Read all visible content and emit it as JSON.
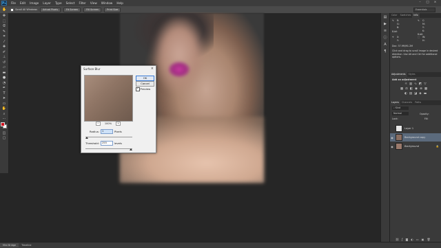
{
  "app": {
    "logo": "Ps"
  },
  "menu": [
    "File",
    "Edit",
    "Image",
    "Layer",
    "Type",
    "Select",
    "Filter",
    "View",
    "Window",
    "Help"
  ],
  "window_controls": [
    "–",
    "□",
    "×"
  ],
  "options_bar": {
    "tool_icon": "hand-icon",
    "scroll_all_label": "Scroll All Windows",
    "buttons": [
      "Actual Pixels",
      "Fit Screen",
      "Fill Screen",
      "Print Size"
    ],
    "workspace": "Essentials"
  },
  "tools": [
    "move-icon",
    "marquee-icon",
    "lasso-icon",
    "quick-select-icon",
    "crop-icon",
    "eyedropper-icon",
    "healing-icon",
    "brush-icon",
    "clone-stamp-icon",
    "history-brush-icon",
    "eraser-icon",
    "gradient-icon",
    "blur-icon",
    "dodge-icon",
    "pen-icon",
    "type-icon",
    "path-select-icon",
    "shape-icon",
    "hand-icon",
    "zoom-icon"
  ],
  "colors": {
    "foreground": "#d0121e",
    "background": "#ffffff",
    "ok_border": "#3a7bd5",
    "lips": "#c93aa0"
  },
  "dialog": {
    "title": "Surface Blur",
    "ok": "OK",
    "cancel": "Cancel",
    "preview_label": "Preview",
    "preview_checked": true,
    "zoom": "100%",
    "zoom_minus": "−",
    "zoom_plus": "+",
    "radius_label": "Radius:",
    "radius_value": "1",
    "radius_unit": "Pixels",
    "threshold_label": "Threshold:",
    "threshold_value": "255",
    "threshold_unit": "levels"
  },
  "info_panel": {
    "tabs": [
      "Color",
      "Swatches",
      "Info"
    ],
    "active_tab": "Info",
    "r": "R:",
    "g": "G:",
    "b": "B:",
    "c": "C:",
    "m": "M:",
    "y": "Y:",
    "k": "K:",
    "x": "X:",
    "yv": "Y:",
    "w": "W:",
    "h": "H:",
    "rgb_bits": "8-bit",
    "cmyk_bits": "8-bit",
    "doc": "Doc: 37.9M/91.2M",
    "hint": "Click and drag to scroll image in desired direction. Use Alt and Ctrl for additional options."
  },
  "adjustments_panel": {
    "tabs": [
      "Adjustments",
      "Styles"
    ],
    "heading": "Add an adjustment",
    "icons_row1": [
      "brightness-icon",
      "levels-icon",
      "curves-icon",
      "exposure-icon",
      "vibrance-icon"
    ],
    "icons_row2": [
      "hue-icon",
      "color-balance-icon",
      "bw-icon",
      "photo-filter-icon",
      "channel-mixer-icon",
      "lookup-icon"
    ],
    "icons_row3": [
      "invert-icon",
      "posterize-icon",
      "threshold-icon",
      "selective-color-icon",
      "gradient-map-icon"
    ]
  },
  "layers_panel": {
    "tabs": [
      "Layers",
      "Channels",
      "Paths"
    ],
    "kind": "Kind",
    "blend_mode": "Normal",
    "opacity_label": "Opacity:",
    "lock_label": "Lock:",
    "fill_label": "Fill:",
    "layers": [
      {
        "name": "Layer 1",
        "visible": false,
        "selected": false,
        "thumb": "#e8e8e8"
      },
      {
        "name": "Background copy",
        "visible": true,
        "selected": true,
        "thumb": "#8a6f62"
      },
      {
        "name": "Background",
        "visible": true,
        "selected": false,
        "thumb": "#9a7a6c",
        "locked": true
      }
    ]
  },
  "status_bar": {
    "tabs": [
      "Mini Bridge",
      "Timeline"
    ],
    "active": "Mini Bridge"
  }
}
